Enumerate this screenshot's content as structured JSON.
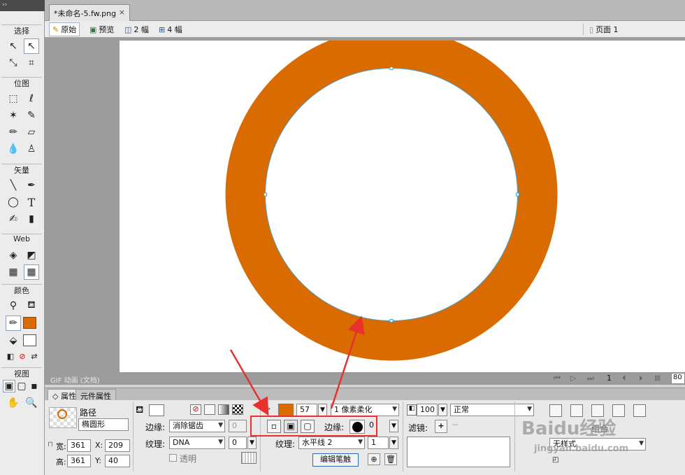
{
  "tabbar": {
    "doc_title": "*未命名-5.fw.png",
    "close_glyph": "×"
  },
  "viewbar": {
    "original": "原始",
    "preview": "预览",
    "two_up": "2 幅",
    "four_up": "4 幅",
    "page": "页面 1"
  },
  "toolbox": {
    "sections": {
      "select": "选择",
      "bitmap": "位图",
      "vector": "矢量",
      "web": "Web",
      "color": "颜色",
      "view": "视图"
    }
  },
  "status": {
    "frame_label": "GIF 动画 (文档)",
    "frame_number": "1",
    "zoom": "80"
  },
  "props": {
    "tabs": [
      "属性",
      "元件属性"
    ],
    "object_type": "路径",
    "object_name": "椭圆形",
    "w_label": "宽:",
    "w": "361",
    "h_label": "高:",
    "h": "361",
    "x_label": "X:",
    "x": "209",
    "y_label": "Y:",
    "y": "40",
    "fill_edge_label": "边缘:",
    "fill_edge_value": "消除锯齿",
    "fill_edge_amount": "0",
    "fill_texture_label": "纹理:",
    "fill_texture_value": "DNA",
    "fill_texture_amount": "0",
    "transparent_label": "透明",
    "stroke_size": "57",
    "stroke_type": "1 像素柔化",
    "stroke_edge_label": "边缘:",
    "stroke_edge_value": "0",
    "stroke_texture_label": "纹理:",
    "stroke_texture_value": "水平线 2",
    "stroke_texture_amount": "1",
    "edit_stroke_button": "编辑笔触",
    "opacity": "100",
    "blend_mode": "正常",
    "filters_label": "滤镜:",
    "style_value": "无样式",
    "style_label": "组合"
  },
  "colors": {
    "accent": "#d96b00",
    "path": "#4aa0c8",
    "highlight": "#e8312f"
  },
  "watermark": {
    "brand": "Baidu经验",
    "url": "jingyan.baidu.com"
  }
}
